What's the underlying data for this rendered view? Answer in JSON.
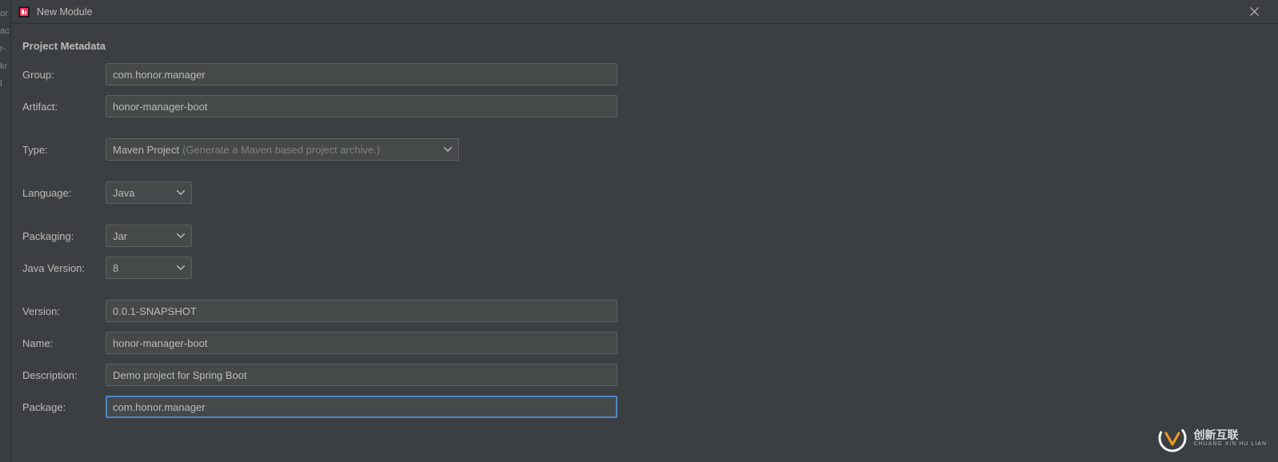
{
  "titlebar": {
    "title": "New Module"
  },
  "section": {
    "title": "Project Metadata"
  },
  "labels": {
    "group": "Group:",
    "artifact": "Artifact:",
    "type": "Type:",
    "language": "Language:",
    "packaging": "Packaging:",
    "java_version": "Java Version:",
    "version": "Version:",
    "name": "Name:",
    "description": "Description:",
    "package": "Package:"
  },
  "values": {
    "group": "com.honor.manager",
    "artifact": "honor-manager-boot",
    "type": "Maven Project",
    "type_hint": "(Generate a Maven based project archive.)",
    "language": "Java",
    "packaging": "Jar",
    "java_version": "8",
    "version": "0.0.1-SNAPSHOT",
    "name": "honor-manager-boot",
    "description": "Demo project for Spring Boot",
    "package": "com.honor.manager"
  },
  "left_edge_fragments": [
    "or",
    "ac",
    "",
    "r-",
    "kr",
    "l"
  ],
  "logo": {
    "main": "创新互联",
    "sub": "CHUANG XIN HU LIAN"
  }
}
